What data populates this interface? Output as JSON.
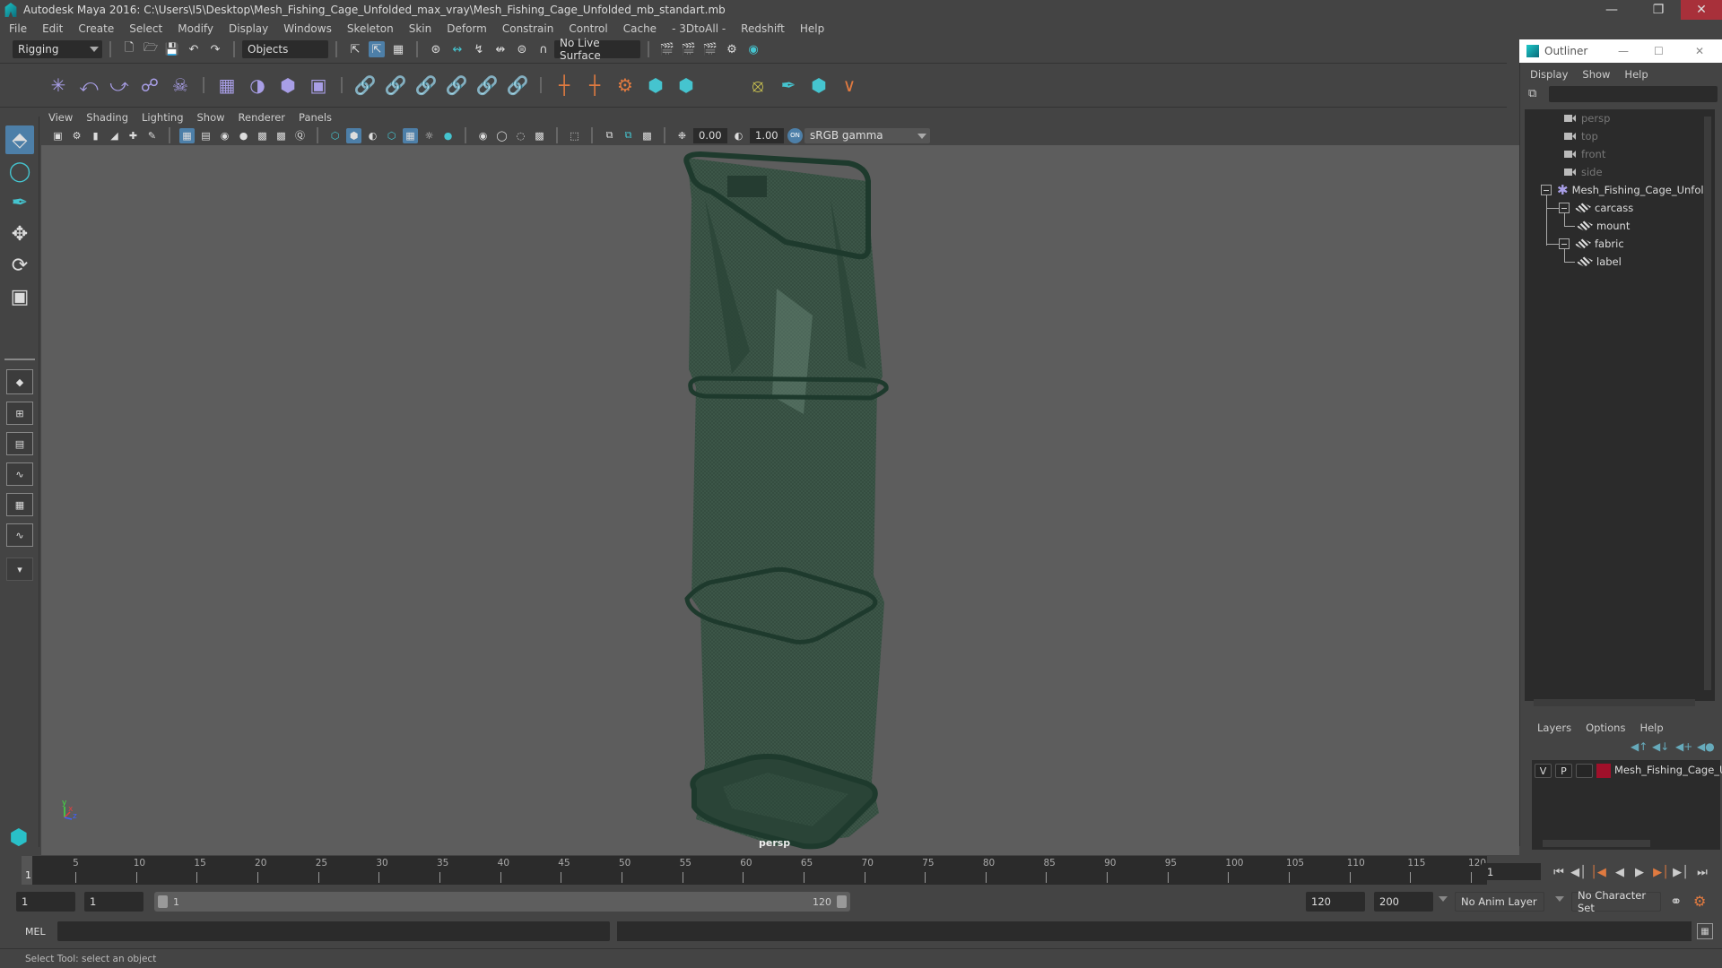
{
  "window": {
    "title": "Autodesk Maya 2016: C:\\Users\\I5\\Desktop\\Mesh_Fishing_Cage_Unfolded_max_vray\\Mesh_Fishing_Cage_Unfolded_mb_standart.mb",
    "minimize_icon": "minimize-icon",
    "restore_icon": "restore-icon",
    "close_icon": "close-icon"
  },
  "menubar": [
    "File",
    "Edit",
    "Create",
    "Select",
    "Modify",
    "Display",
    "Windows",
    "Skeleton",
    "Skin",
    "Deform",
    "Constrain",
    "Control",
    "Cache",
    "- 3DtoAll -",
    "Redshift",
    "Help"
  ],
  "statusline": {
    "menuset": "Rigging",
    "selection_mode": "Objects",
    "live_surface": "No Live Surface"
  },
  "viewport_panel": {
    "menus": [
      "View",
      "Shading",
      "Lighting",
      "Show",
      "Renderer",
      "Panels"
    ],
    "exposure": "0.00",
    "gamma": "1.00",
    "color_management_toggle": "ON",
    "view_transform": "sRGB gamma",
    "camera_label": "persp",
    "colors": {
      "background": "#5d5d5d",
      "mesh": "#2f4d3f",
      "rim": "#1f3a2e"
    }
  },
  "timeline": {
    "ticks": [
      5,
      10,
      15,
      20,
      25,
      30,
      35,
      40,
      45,
      50,
      55,
      60,
      65,
      70,
      75,
      80,
      85,
      90,
      95,
      100,
      105,
      110,
      115,
      120
    ],
    "start": 1,
    "end": 120,
    "current_frame": "1",
    "current_frame_field": "1"
  },
  "range": {
    "start_time": "1",
    "playback_start": "1",
    "slider_start_label": "1",
    "slider_end_label": "120",
    "playback_end": "120",
    "end_time": "200",
    "anim_layer": "No Anim Layer",
    "character_set": "No Character Set"
  },
  "command_line": {
    "language": "MEL",
    "input": "",
    "help_text": "Select Tool: select an object"
  },
  "outliner": {
    "title": "Outliner",
    "menus": [
      "Display",
      "Show",
      "Help"
    ],
    "search": "",
    "items": [
      {
        "label": "persp",
        "type": "camera",
        "dim": true
      },
      {
        "label": "top",
        "type": "camera",
        "dim": true
      },
      {
        "label": "front",
        "type": "camera",
        "dim": true
      },
      {
        "label": "side",
        "type": "camera",
        "dim": true
      },
      {
        "label": "Mesh_Fishing_Cage_Unfold",
        "type": "group",
        "expanded": true
      },
      {
        "label": "carcass",
        "type": "mesh",
        "expanded": true
      },
      {
        "label": "mount",
        "type": "mesh"
      },
      {
        "label": "fabric",
        "type": "mesh",
        "expanded": true
      },
      {
        "label": "label",
        "type": "mesh"
      }
    ]
  },
  "layers": {
    "menus": [
      "Layers",
      "Options",
      "Help"
    ],
    "rows": [
      {
        "visible": "V",
        "playback": "P",
        "type": "",
        "color": "#a0102a",
        "name": "Mesh_Fishing_Cage_U"
      }
    ]
  }
}
